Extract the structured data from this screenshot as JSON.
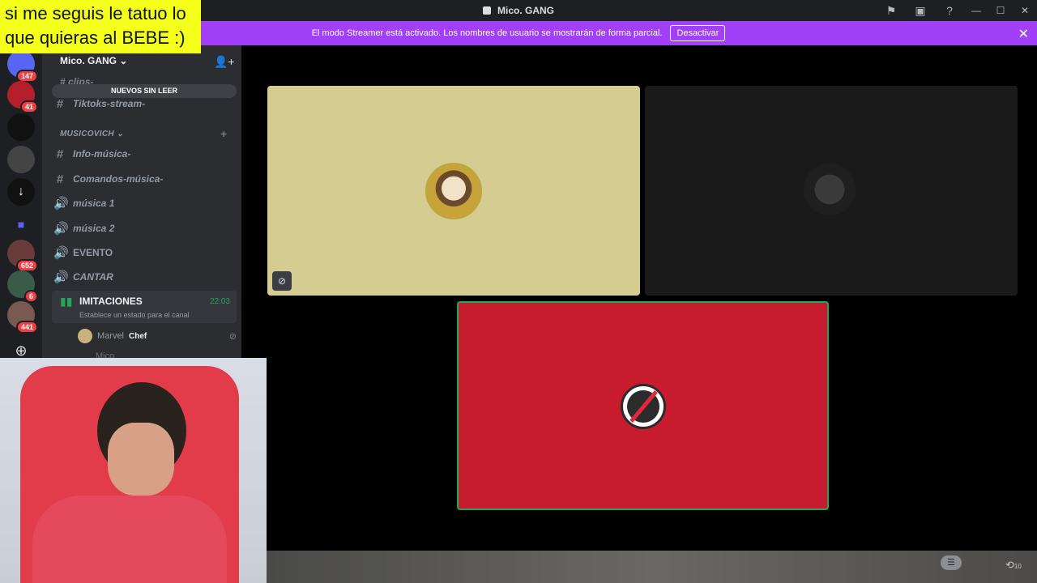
{
  "window": {
    "title": "Mico. GANG"
  },
  "overlay": {
    "text_line1": "si me seguis le tatuo lo",
    "text_line2": "que quieras al BEBE :)"
  },
  "banner": {
    "message": "El modo Streamer está activado. Los nombres de usuario se mostrarán de forma parcial.",
    "button_label": "Desactivar",
    "close": "✕"
  },
  "guilds": [
    {
      "badge": "147"
    },
    {
      "badge": "41"
    },
    {
      "badge": ""
    },
    {
      "badge": ""
    },
    {
      "badge": ""
    },
    {
      "badge": ""
    },
    {
      "badge": "652"
    },
    {
      "badge": "6"
    },
    {
      "badge": "441"
    }
  ],
  "sidebar": {
    "server_name": "Mico. GANG",
    "unread_pill": "NUEVOS SIN LEER",
    "clips_channel": "clips-",
    "channels_top": [
      {
        "name": "Tiktoks-stream-",
        "icon": "#"
      }
    ],
    "category": "MUSICOVICH",
    "channels": [
      {
        "name": "Info-música-",
        "icon": "#"
      },
      {
        "name": "Comandos-música-",
        "icon": "#"
      },
      {
        "name": "música 1",
        "icon": "🔊"
      },
      {
        "name": "música 2",
        "icon": "🔊"
      },
      {
        "name": "EVENTO",
        "icon": "🔊"
      },
      {
        "name": "CANTAR",
        "icon": "🔊"
      }
    ],
    "active_channel": {
      "name": "IMITACIONES",
      "time": "22:03",
      "status": "Establece un estado para el canal"
    },
    "members": [
      {
        "name": "Marvel",
        "role": "Chef"
      },
      {
        "name": "Mico"
      }
    ]
  },
  "colors": {
    "accent": "#a23ff8",
    "voice_green": "#23a55a",
    "tile1_bg": "#d5cc92",
    "tile3_bg": "#c61c2d"
  },
  "bottom": {
    "clock_label": "10"
  }
}
